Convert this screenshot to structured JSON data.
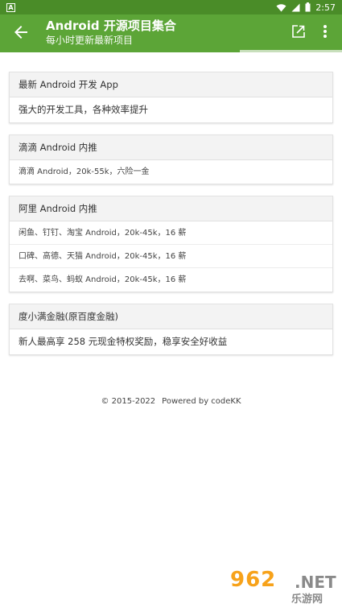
{
  "status_bar": {
    "app_badge": "A",
    "time": "2:57",
    "icons": [
      "wifi-icon",
      "signal-icon",
      "battery-icon"
    ]
  },
  "app_bar": {
    "title": "Android 开源项目集合",
    "subtitle": "每小时更新最新项目",
    "icons": [
      "back-arrow-icon",
      "share-icon",
      "more-vert-icon"
    ]
  },
  "page_load_progress_percent": 70,
  "cards": [
    {
      "header": "最新 Android 开发 App",
      "rows": [
        "强大的开发工具，各种效率提升"
      ]
    },
    {
      "header": "滴滴 Android 内推",
      "rows": [
        "滴滴 Android，20k-55k，六险一金"
      ]
    },
    {
      "header": "阿里 Android 内推",
      "rows": [
        "闲鱼、钉钉、淘宝 Android，20k-45k，16 薪",
        "口碑、高德、天猫 Android，20k-45k，16 薪",
        "去啊、菜鸟、蚂蚁 Android，20k-45k，16 薪"
      ]
    },
    {
      "header": "度小满金融(原百度金融)",
      "rows": [
        "新人最高享 258 元现金特权奖励，稳享安全好收益"
      ]
    }
  ],
  "footer": {
    "copyright": "© 2015-2022",
    "powered": "Powered by codeKK"
  },
  "watermark": {
    "number": "962",
    "net": ".NET",
    "cn": "乐游网"
  },
  "colors": {
    "status_bar": "#4a8c28",
    "app_bar": "#5ca537",
    "card_header_bg": "#f3f3f3",
    "watermark_orange": "#f7a21a"
  }
}
